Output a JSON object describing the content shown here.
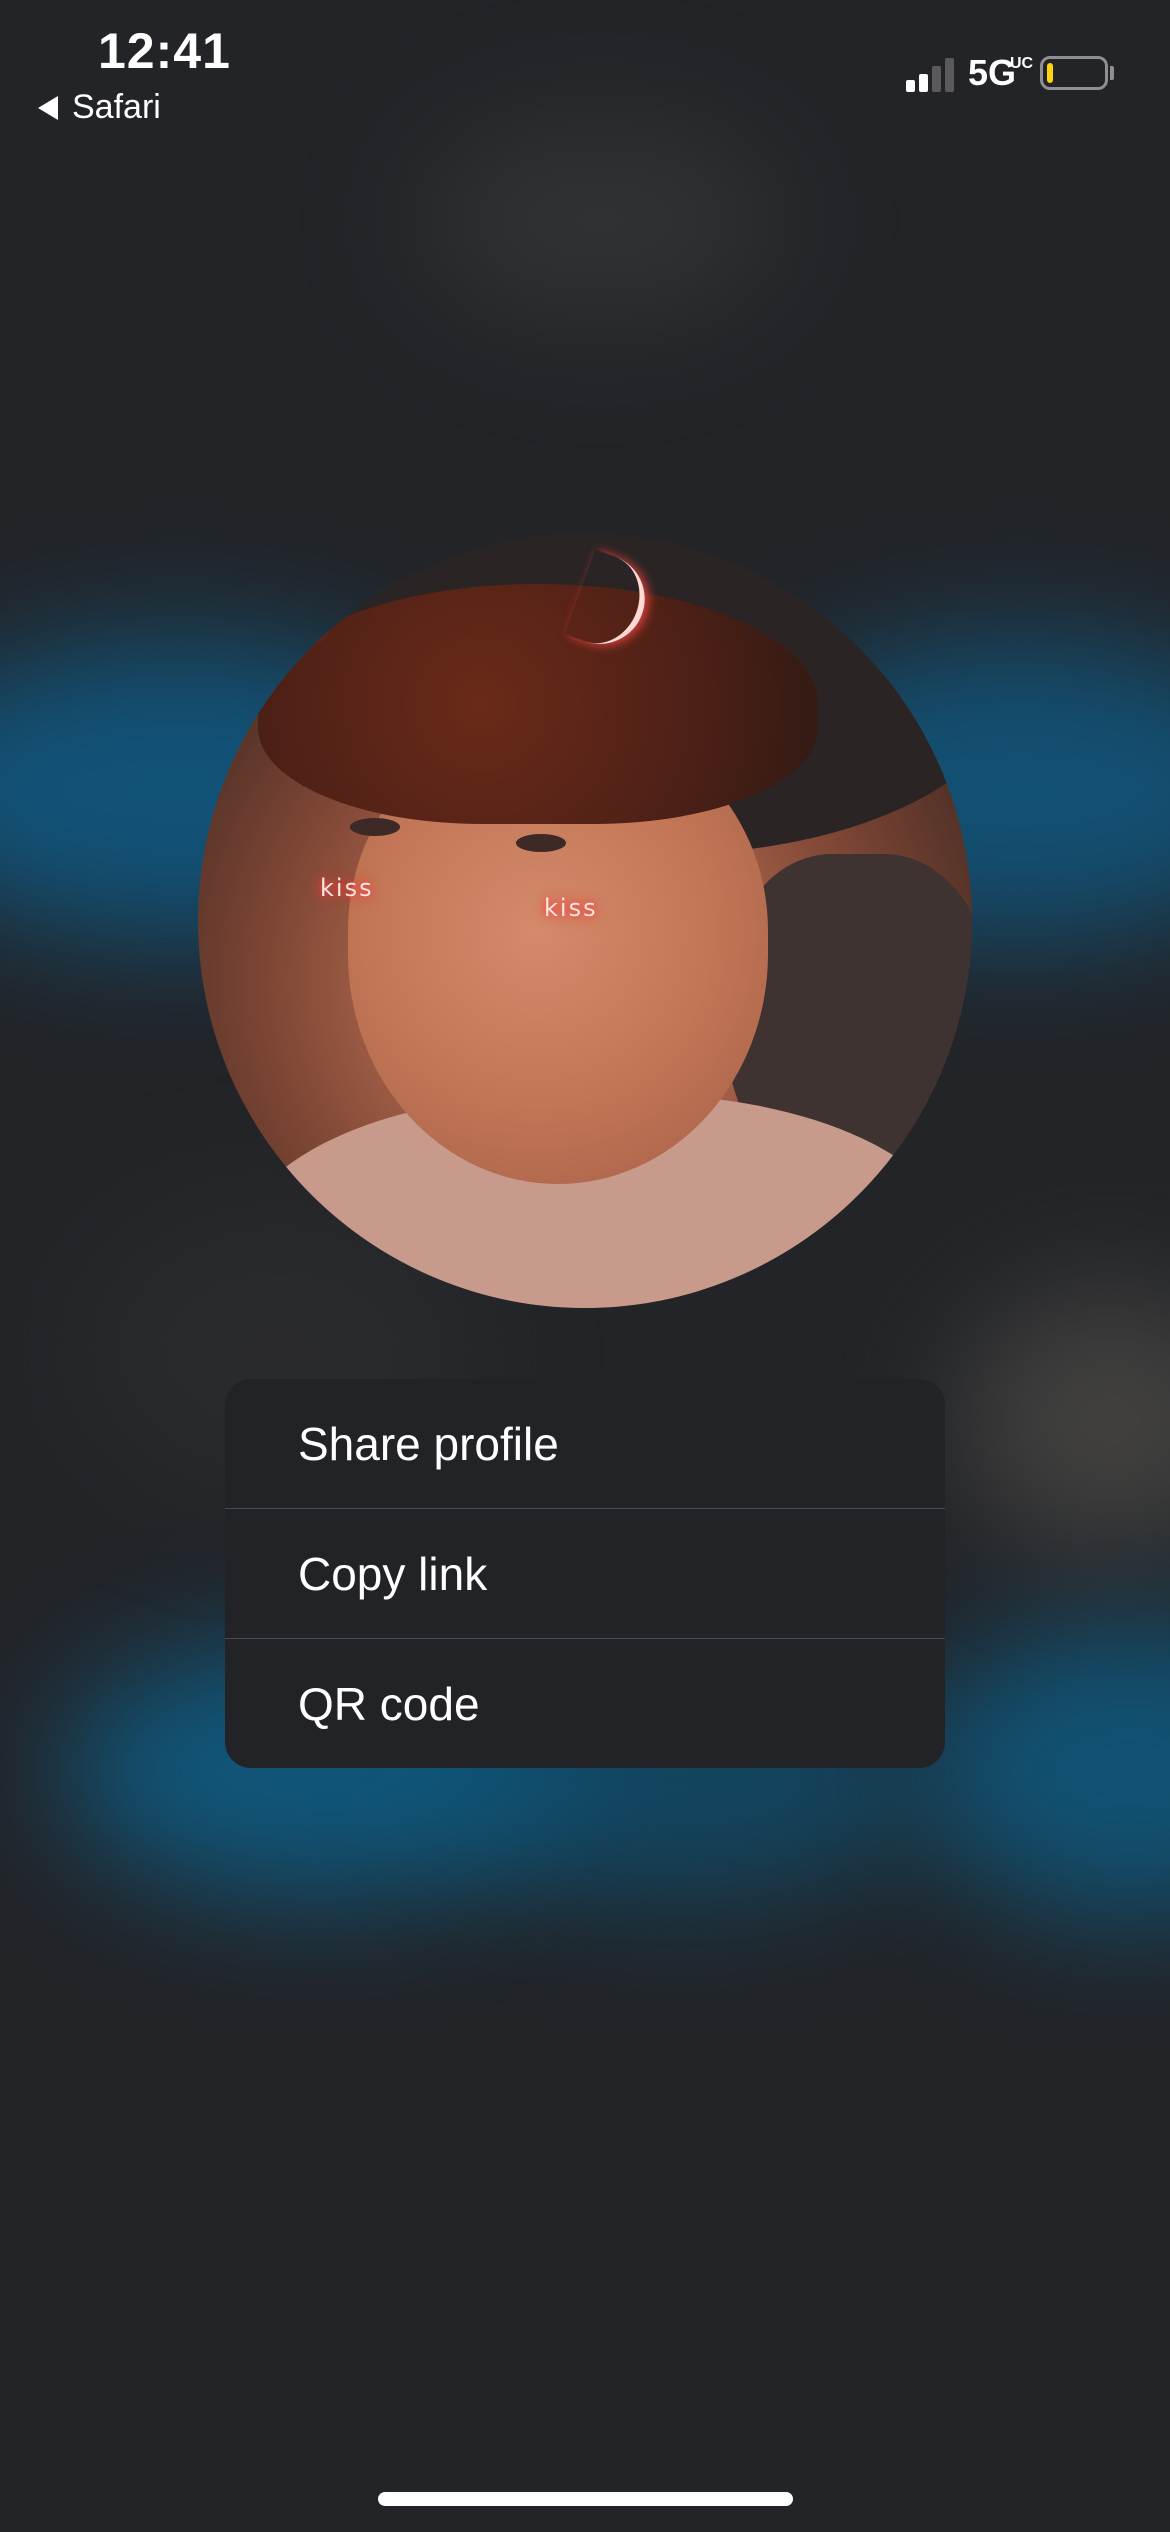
{
  "status_bar": {
    "time": "12:41",
    "back_app_label": "Safari",
    "network": "5G",
    "network_suffix": "UC",
    "battery_level": 0.1,
    "battery_color": "#ffd60a",
    "signal_bars_active": 2,
    "signal_bars_total": 4,
    "icons": [
      "back-arrow-icon",
      "signal-icon",
      "battery-icon"
    ]
  },
  "profile": {
    "avatar_stickers": [
      "kiss",
      "kiss"
    ]
  },
  "menu": {
    "items": [
      {
        "label": "Share profile"
      },
      {
        "label": "Copy link"
      },
      {
        "label": "QR code"
      }
    ]
  },
  "colors": {
    "background": "#222428",
    "menu_background": "#222327",
    "accent_glow": "#0f5b86"
  }
}
